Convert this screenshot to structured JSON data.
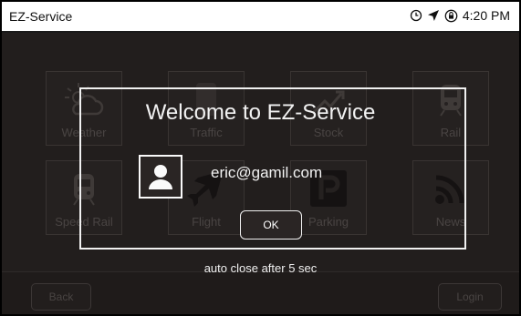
{
  "statusbar": {
    "app_title": "EZ-Service",
    "time": "4:20 PM",
    "icons": [
      "clock-icon",
      "location-arrow-icon",
      "lock-rotation-icon"
    ]
  },
  "tiles": [
    {
      "label": "Weather",
      "icon": "weather-icon"
    },
    {
      "label": "Traffic",
      "icon": "traffic-icon"
    },
    {
      "label": "Stock",
      "icon": "stock-icon"
    },
    {
      "label": "Rail",
      "icon": "train-icon"
    },
    {
      "label": "Speed Rail",
      "icon": "speed-rail-icon"
    },
    {
      "label": "Flight",
      "icon": "airplane-icon"
    },
    {
      "label": "Parking",
      "icon": "parking-icon"
    },
    {
      "label": "News",
      "icon": "rss-icon"
    }
  ],
  "bottombar": {
    "back_label": "Back",
    "login_label": "Login"
  },
  "dialog": {
    "title": "Welcome to EZ-Service",
    "email": "eric@gamil.com",
    "ok_label": "OK",
    "auto_close_text": "auto close after 5 sec"
  },
  "colors": {
    "background": "#2a2524",
    "dialog_border": "#f0f0f0",
    "statusbar_bg": "#ffffff"
  }
}
